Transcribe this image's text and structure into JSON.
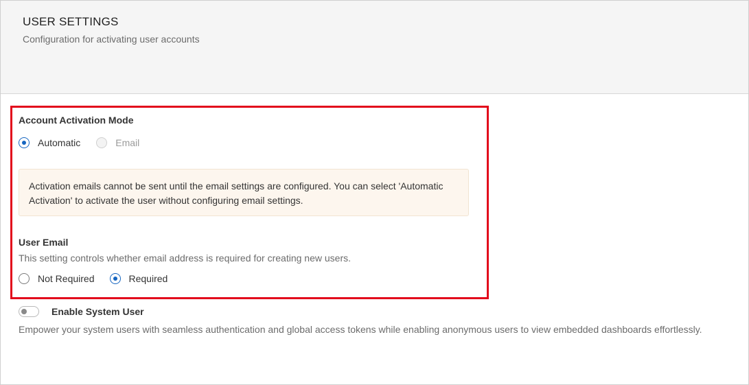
{
  "header": {
    "title": "USER SETTINGS",
    "subtitle": "Configuration for activating user accounts"
  },
  "activation_mode": {
    "label": "Account Activation Mode",
    "options": [
      {
        "label": "Automatic",
        "checked": true,
        "disabled": false
      },
      {
        "label": "Email",
        "checked": false,
        "disabled": true
      }
    ],
    "warning": "Activation emails cannot be sent until the email settings are configured. You can select 'Automatic Activation' to activate the user without configuring email settings."
  },
  "user_email": {
    "label": "User Email",
    "description": "This setting controls whether email address is required for creating new users.",
    "options": [
      {
        "label": "Not Required",
        "checked": false
      },
      {
        "label": "Required",
        "checked": true
      }
    ]
  },
  "system_user": {
    "label": "Enable System User",
    "enabled": false,
    "description": "Empower your system users with seamless authentication and global access tokens while enabling anonymous users to view embedded dashboards effortlessly."
  },
  "colors": {
    "accent": "#1565c0",
    "highlight_border": "#e2071b",
    "warning_bg": "#fdf6ee"
  }
}
